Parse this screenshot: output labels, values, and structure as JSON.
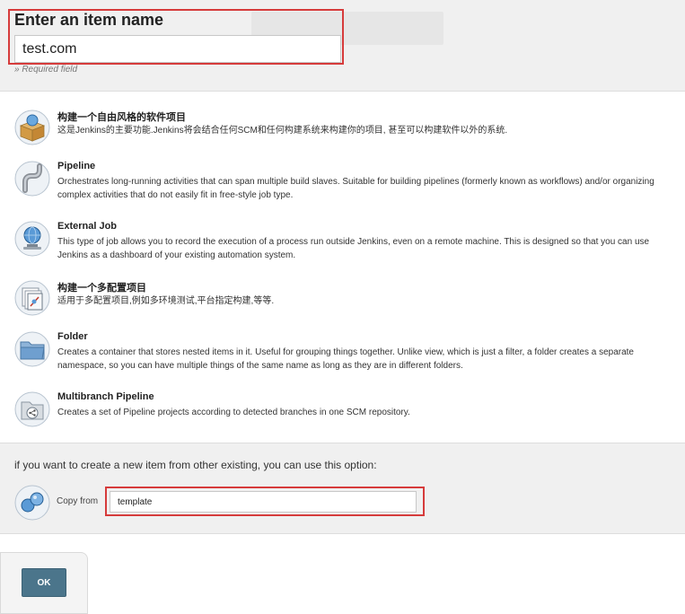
{
  "name_section": {
    "title": "Enter an item name",
    "input_value": "test.com",
    "required_note": "» Required field"
  },
  "items": [
    {
      "label": "构建一个自由风格的软件项目",
      "description": "这是Jenkins的主要功能.Jenkins将会结合任何SCM和任何构建系统来构建你的项目, 甚至可以构建软件以外的系统.",
      "icon": "freestyle-box-icon"
    },
    {
      "label": "Pipeline",
      "description": "Orchestrates long-running activities that can span multiple build slaves. Suitable for building pipelines (formerly known as workflows) and/or organizing complex activities that do not easily fit in free-style job type.",
      "icon": "pipeline-icon"
    },
    {
      "label": "External Job",
      "description": "This type of job allows you to record the execution of a process run outside Jenkins, even on a remote machine. This is designed so that you can use Jenkins as a dashboard of your existing automation system.",
      "icon": "monitor-globe-icon"
    },
    {
      "label": "构建一个多配置项目",
      "description": "适用于多配置项目,例如多环境测试,平台指定构建,等等.",
      "icon": "multi-config-icon"
    },
    {
      "label": "Folder",
      "description": "Creates a container that stores nested items in it. Useful for grouping things together. Unlike view, which is just a filter, a folder creates a separate namespace, so you can have multiple things of the same name as long as they are in different folders.",
      "icon": "folder-icon"
    },
    {
      "label": "Multibranch Pipeline",
      "description": "Creates a set of Pipeline projects according to detected branches in one SCM repository.",
      "icon": "multibranch-icon"
    }
  ],
  "copy_section": {
    "heading": "if you want to create a new item from other existing, you can use this option:",
    "label": "Copy from",
    "input_value": "template",
    "icon": "copy-icon"
  },
  "ok_button": {
    "label": "OK"
  },
  "colors": {
    "highlight_border": "#d63b3b",
    "ok_button": "#4b758b",
    "panel_bg": "#f0f0f0"
  }
}
